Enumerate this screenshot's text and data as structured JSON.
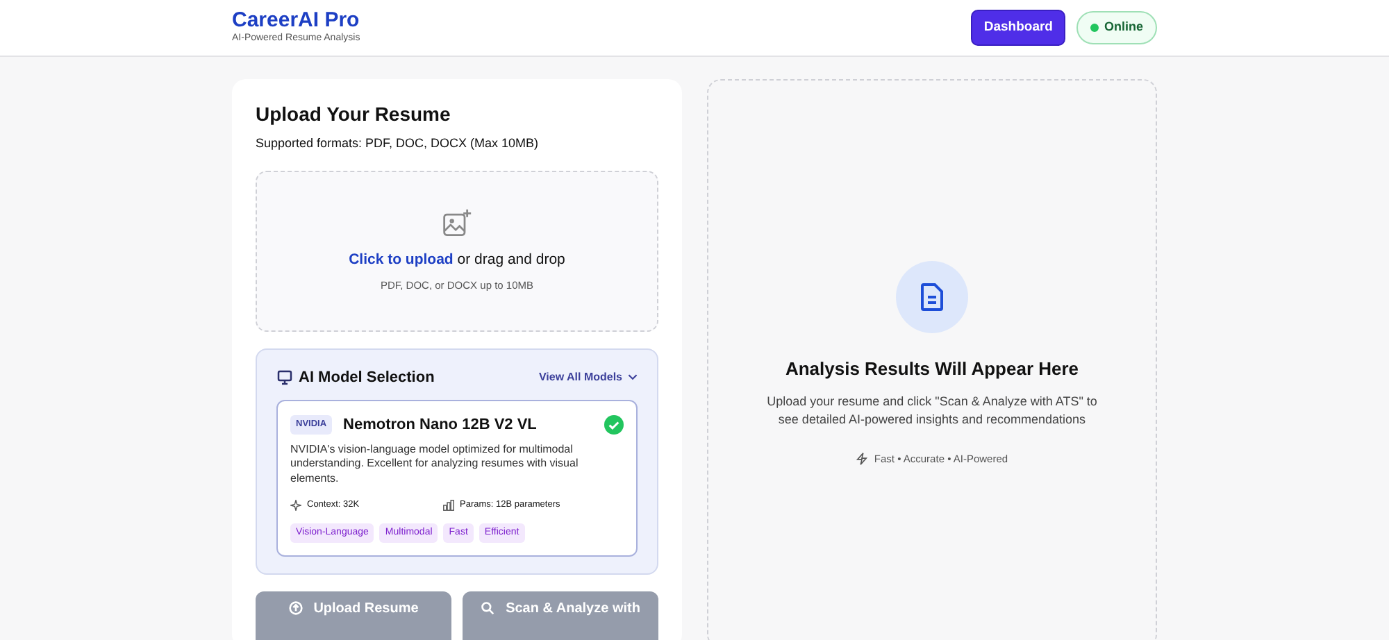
{
  "header": {
    "brand": "CareerAI Pro",
    "tagline": "AI-Powered Resume Analysis",
    "dashboard_button": "Dashboard",
    "status": {
      "label": "Online",
      "on": true
    }
  },
  "upload": {
    "title": "Upload Your Resume",
    "formats": "Supported formats: PDF, DOC, DOCX (Max 10MB)",
    "dropzone": {
      "link": "Click to upload",
      "text": "or drag and drop",
      "hint": "PDF, DOC, or DOCX up to 10MB"
    }
  },
  "model_selection": {
    "title": "AI Model Selection",
    "view_all": "View All Models",
    "model": {
      "vendor": "NVIDIA",
      "name": "Nemotron Nano 12B V2 VL",
      "selected": true,
      "description": "NVIDIA's vision-language model optimized for multimodal understanding. Excellent for analyzing resumes with visual elements.",
      "context": "Context: 32K",
      "params": "Params: 12B parameters",
      "tags": [
        "Vision-Language",
        "Multimodal",
        "Fast",
        "Efficient"
      ]
    }
  },
  "actions": [
    {
      "label": "Upload Resume",
      "kind": "upload",
      "disabled": true
    },
    {
      "label": "Scan & Analyze with",
      "kind": "analyze",
      "disabled": true
    }
  ],
  "results": {
    "title": "Analysis Results Will Appear Here",
    "description": "Upload your resume and click \"Scan & Analyze with ATS\" to see detailed AI-powered insights and recommendations",
    "features": "Fast • Accurate • AI-Powered"
  }
}
